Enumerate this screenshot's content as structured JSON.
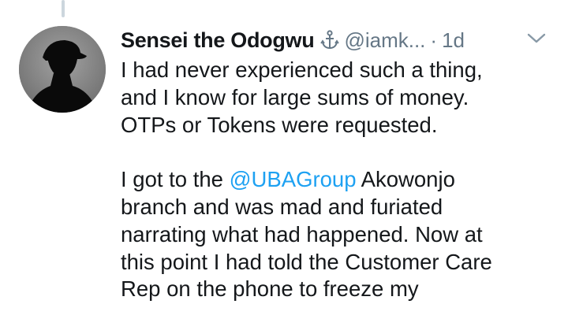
{
  "tweet": {
    "display_name": "Sensei the Odogwu",
    "badge_icon": "anchor-icon",
    "handle": "@iamk...",
    "separator": "·",
    "timestamp": "1d",
    "menu_icon": "chevron-down-icon",
    "paragraph1": [
      "I had never experienced such a thing,",
      "and I know for large sums of money.",
      "OTPs or Tokens were requested."
    ],
    "paragraph2": {
      "line1_prefix": "I got to the ",
      "mention": "@UBAGroup",
      "line1_suffix": " Akowonjo",
      "lines": [
        "branch and was mad and furiated",
        "narrating what had happened. Now at",
        "this point I had told the Customer Care",
        "Rep on the phone to freeze my"
      ]
    }
  },
  "colors": {
    "text": "#14171a",
    "secondary": "#657786",
    "link": "#1da1f2",
    "thread_line": "#ccd6dd"
  }
}
